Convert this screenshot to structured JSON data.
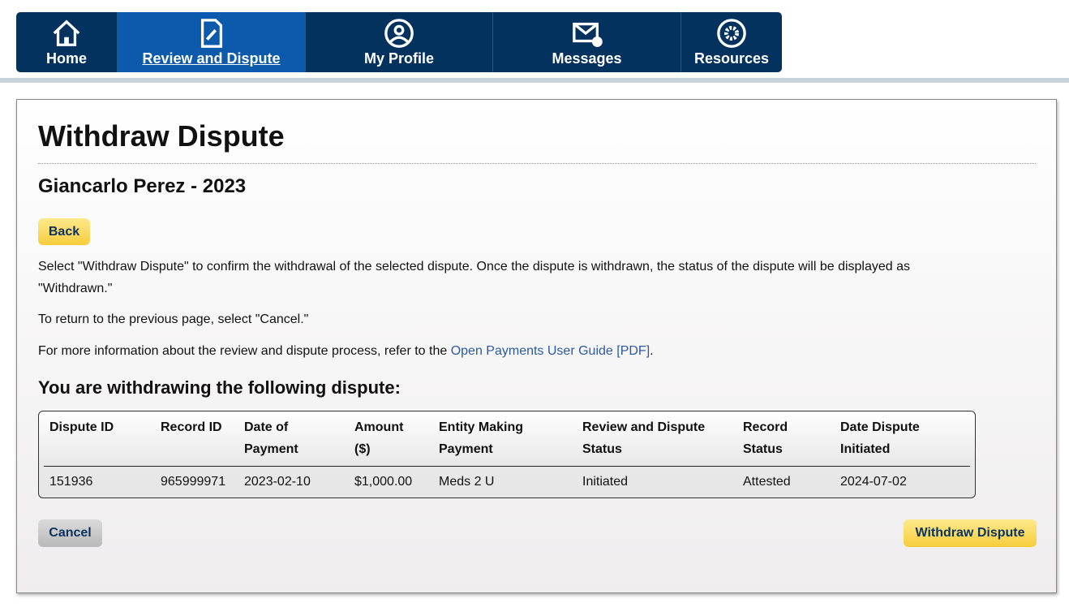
{
  "nav": {
    "tabs": [
      {
        "label": "Home",
        "icon": "home-icon"
      },
      {
        "label": "Review and Dispute",
        "icon": "document-edit-icon",
        "active": true
      },
      {
        "label": "My Profile",
        "icon": "user-circle-icon"
      },
      {
        "label": "Messages",
        "icon": "envelope-icon"
      },
      {
        "label": "Resources",
        "icon": "gear-icon"
      }
    ]
  },
  "page": {
    "title": "Withdraw Dispute",
    "subtitle": "Giancarlo Perez - 2023",
    "back": "Back",
    "p1": "Select \"Withdraw Dispute\" to confirm the withdrawal of the selected dispute. Once the dispute is withdrawn, the status of the dispute will be displayed as \"Withdrawn.\"",
    "p2": "To return to the previous page, select \"Cancel.\"",
    "p3_pre": "For more information about the review and dispute process, refer to the ",
    "p3_link": "Open Payments User Guide [PDF]",
    "p3_post": ".",
    "section": "You are withdrawing the following dispute:"
  },
  "table": {
    "headers": [
      "Dispute ID",
      "Record ID",
      "Date of Payment",
      "Amount ($)",
      "Entity Making Payment",
      "Review and Dispute Status",
      "Record Status",
      "Date Dispute Initiated"
    ],
    "row": [
      "151936",
      "965999971",
      "2023-02-10",
      "$1,000.00",
      "Meds 2 U",
      "Initiated",
      "Attested",
      "2024-07-02"
    ]
  },
  "actions": {
    "cancel": "Cancel",
    "withdraw": "Withdraw Dispute"
  }
}
